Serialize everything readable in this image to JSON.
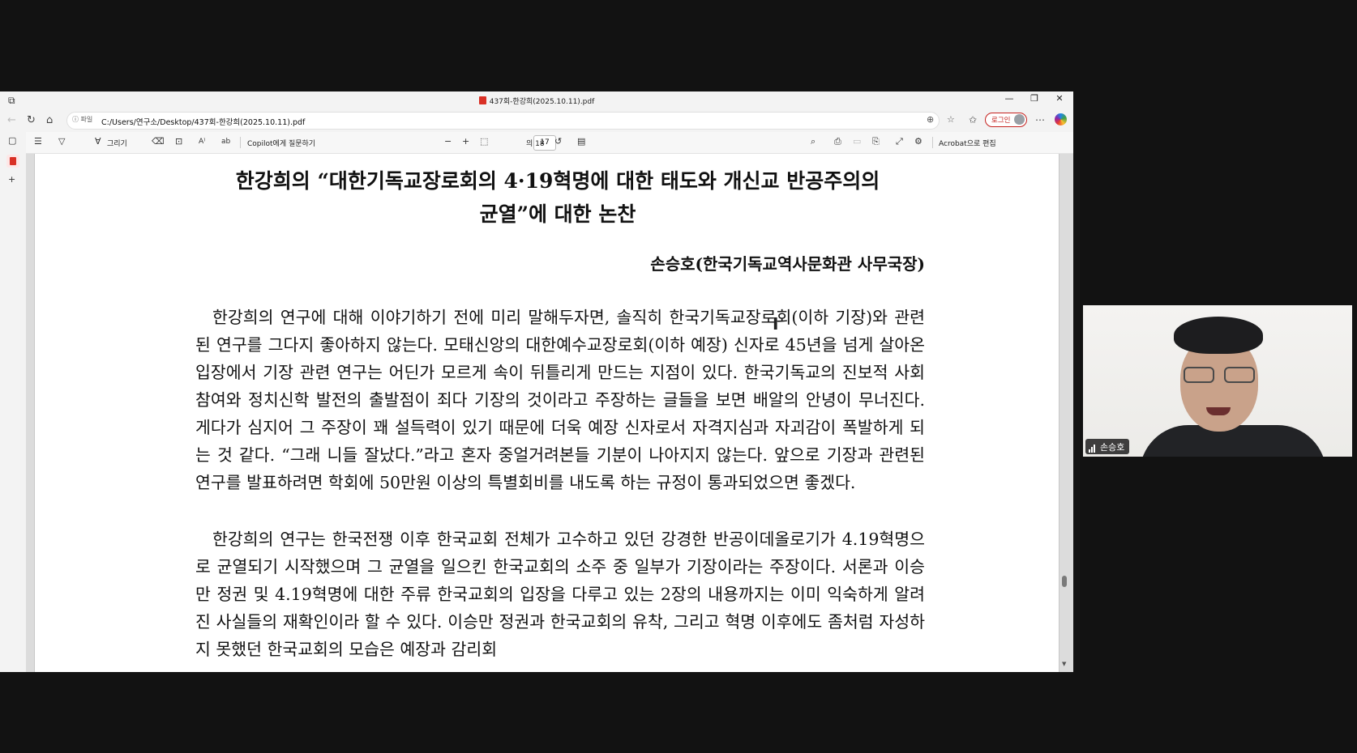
{
  "browser": {
    "tab_title": "437회-한강희(2025.10.11).pdf",
    "address_chip": "파일",
    "url": "C:/Users/연구소/Desktop/437회-한강희(2025.10.11).pdf",
    "login_label": "로그인",
    "window_controls": [
      "—",
      "❐",
      "✕"
    ]
  },
  "pdf_toolbar": {
    "draw_label": "그리기",
    "copilot_label": "Copilot에게 질문하기",
    "current_page": "17",
    "page_total": "의 18",
    "acrobat_label": "Acrobat으로 편집"
  },
  "document": {
    "title_line1": "한강희의 “대한기독교장로회의 4·19혁명에 대한 태도와 개신교 반공주의의",
    "title_line2": "균열”에 대한 논찬",
    "author": "손승호(한국기독교역사문화관 사무국장)",
    "paragraph1": "한강희의 연구에 대해 이야기하기 전에 미리 말해두자면, 솔직히 한국기독교장로회(이하 기장)와 관련된 연구를 그다지 좋아하지 않는다. 모태신앙의 대한예수교장로회(이하 예장) 신자로 45년을 넘게 살아온 입장에서 기장 관련 연구는 어딘가 모르게 속이 뒤틀리게 만드는 지점이 있다. 한국기독교의 진보적 사회참여와 정치신학 발전의 출발점이 죄다 기장의 것이라고 주장하는 글들을 보면 배알의 안녕이 무너진다. 게다가 심지어 그 주장이 꽤 설득력이 있기 때문에 더욱 예장 신자로서 자격지심과 자괴감이 폭발하게 되는 것 같다. “그래 니들 잘났다.”라고 혼자 중얼거려본들 기분이 나아지지 않는다. 앞으로 기장과 관련된 연구를 발표하려면 학회에 50만원 이상의 특별회비를 내도록 하는 규정이 통과되었으면 좋겠다.",
    "paragraph2": "한강희의 연구는 한국전쟁 이후 한국교회 전체가 고수하고 있던 강경한 반공이데올로기가 4.19혁명으로 균열되기 시작했으며 그 균열을 일으킨 한국교회의 소주 중 일부가 기장이라는 주장이다. 서론과 이승만 정권 및 4.19혁명에 대한 주류 한국교회의 입장을 다루고 있는 2장의 내용까지는 이미 익숙하게 알려진 사실들의 재확인이라 할 수 있다. 이승만 정권과 한국교회의 유착, 그리고 혁명 이후에도 좀처럼 자성하지 못했던 한국교회의 모습은 예장과 감리회"
  },
  "webcam": {
    "participant_name": "손승호"
  }
}
